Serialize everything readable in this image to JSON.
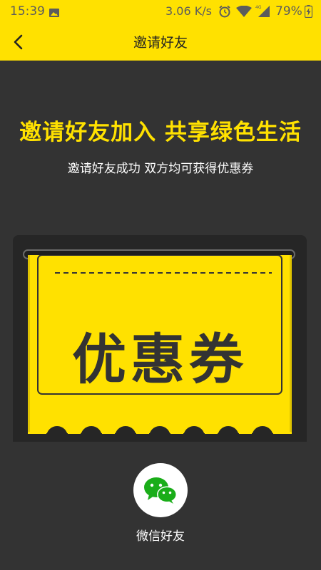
{
  "status_bar": {
    "time": "15:39",
    "network_speed": "3.06 K/s",
    "battery": "79%",
    "icons": [
      "image-icon",
      "alarm-icon",
      "wifi-icon",
      "signal-icon",
      "battery-icon"
    ]
  },
  "app_bar": {
    "title": "邀请好友",
    "back_icon": "chevron-left-icon"
  },
  "headline": "邀请好友加入 共享绿色生活",
  "subtitle": "邀请好友成功 双方均可获得优惠券",
  "coupon": {
    "label": "优惠券"
  },
  "share": {
    "wechat_label": "微信好友",
    "wechat_icon": "wechat-icon"
  },
  "colors": {
    "accent_yellow": "#FFE100",
    "background_dark": "#333333",
    "panel_dark": "#262626",
    "wechat_green": "#1AAD19"
  }
}
